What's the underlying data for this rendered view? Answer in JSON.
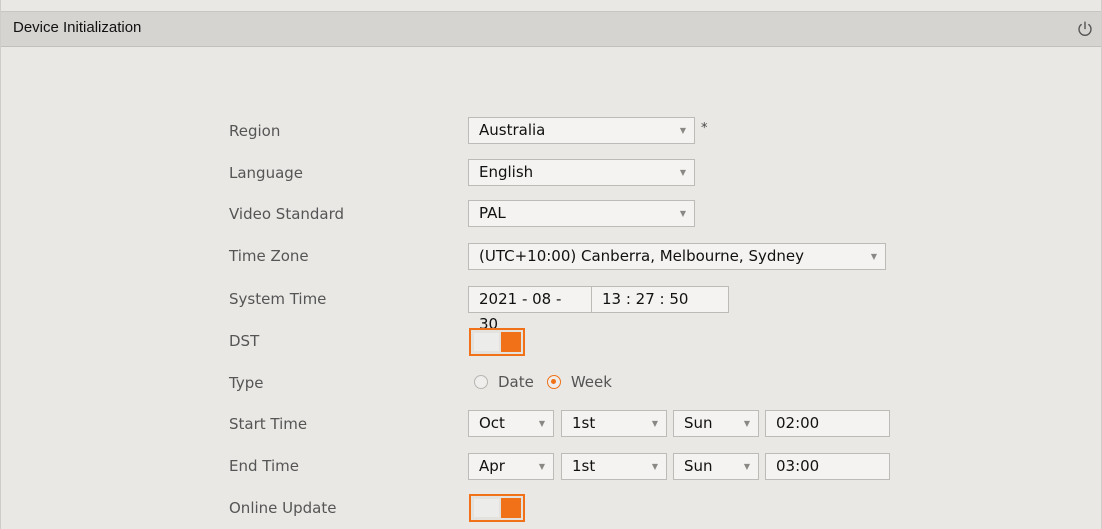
{
  "window": {
    "title": "Device Initialization",
    "power_icon": "power-icon"
  },
  "fields": {
    "region": {
      "label": "Region",
      "value": "Australia",
      "required_mark": "*"
    },
    "language": {
      "label": "Language",
      "value": "English"
    },
    "video_standard": {
      "label": "Video Standard",
      "value": "PAL"
    },
    "time_zone": {
      "label": "Time Zone",
      "value": "(UTC+10:00) Canberra, Melbourne, Sydney"
    },
    "system_time": {
      "label": "System Time",
      "date": "2021 - 08 - 30",
      "time": "13 : 27 : 50"
    },
    "dst": {
      "label": "DST",
      "enabled": true
    },
    "type": {
      "label": "Type",
      "options": [
        "Date",
        "Week"
      ],
      "selected": "Week"
    },
    "start_time": {
      "label": "Start Time",
      "month": "Oct",
      "week": "1st",
      "day": "Sun",
      "time": "02:00"
    },
    "end_time": {
      "label": "End Time",
      "month": "Apr",
      "week": "1st",
      "day": "Sun",
      "time": "03:00"
    },
    "online_update": {
      "label": "Online Update",
      "enabled": true
    }
  },
  "colors": {
    "accent": "#f07117",
    "background": "#e9e8e5",
    "titlebar": "#d6d4d0"
  }
}
